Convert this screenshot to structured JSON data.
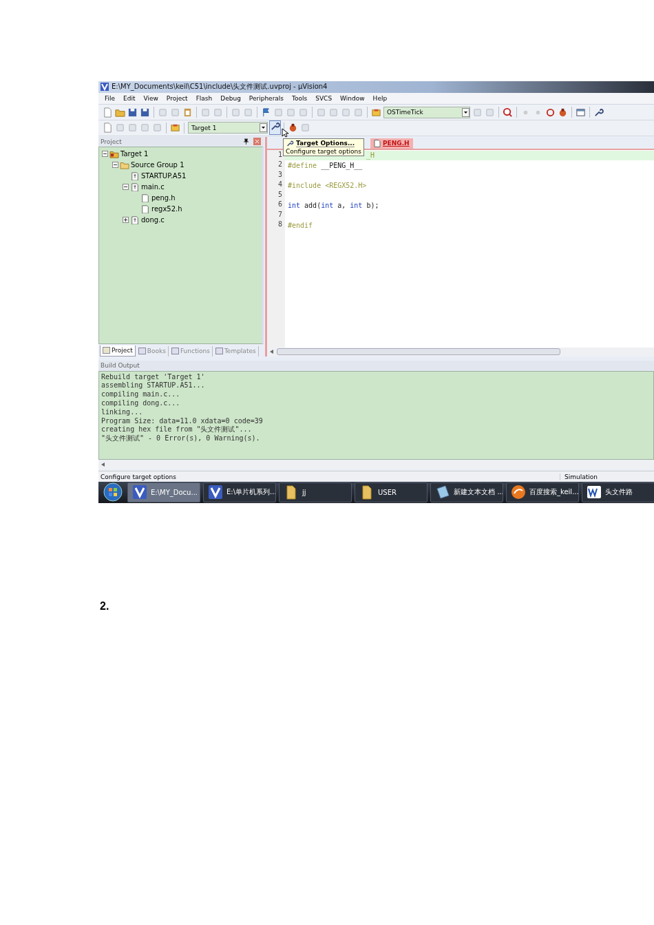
{
  "window": {
    "title": "E:\\MY_Documents\\keil\\C51\\include\\头文件测试.uvproj - µVision4"
  },
  "menu": [
    "File",
    "Edit",
    "View",
    "Project",
    "Flash",
    "Debug",
    "Peripherals",
    "Tools",
    "SVCS",
    "Window",
    "Help"
  ],
  "toolbar": {
    "function_combo": "OSTimeTick",
    "target_combo": "Target 1"
  },
  "project_panel": {
    "title": "Project",
    "tree": [
      {
        "label": "Target 1",
        "kind": "target",
        "expanded": true,
        "children": [
          {
            "label": "Source Group 1",
            "kind": "group",
            "expanded": true,
            "children": [
              {
                "label": "STARTUP.A51",
                "kind": "file"
              },
              {
                "label": "main.c",
                "kind": "file",
                "expanded": true,
                "children": [
                  {
                    "label": "peng.h",
                    "kind": "header"
                  },
                  {
                    "label": "regx52.h",
                    "kind": "header"
                  }
                ]
              },
              {
                "label": "dong.c",
                "kind": "file",
                "expanded": false
              }
            ]
          }
        ]
      }
    ],
    "tabs": [
      {
        "label": "Project",
        "selected": true
      },
      {
        "label": "Books",
        "selected": false
      },
      {
        "label": "Functions",
        "selected": false
      },
      {
        "label": "Templates",
        "selected": false
      }
    ]
  },
  "editor": {
    "tabs": [
      {
        "label": "PENG.H",
        "selected": true
      }
    ],
    "lines": [
      {
        "number": "1",
        "current": true,
        "tokens": [
          {
            "kind": "tail",
            "text": "_H"
          }
        ]
      },
      {
        "number": "2",
        "current": false,
        "tokens": [
          {
            "kind": "preproc",
            "text": "#define"
          },
          {
            "kind": "plain",
            "text": " __PENG_H__"
          }
        ]
      },
      {
        "number": "3",
        "current": false
      },
      {
        "number": "4",
        "current": false,
        "tokens": [
          {
            "kind": "preproc",
            "text": "#include <REGX52.H>"
          }
        ]
      },
      {
        "number": "5",
        "current": false
      },
      {
        "number": "6",
        "current": false,
        "tokens": [
          {
            "kind": "keyword",
            "text": "int"
          },
          {
            "kind": "plain",
            "text": " add("
          },
          {
            "kind": "keyword",
            "text": "int"
          },
          {
            "kind": "plain",
            "text": " a, "
          },
          {
            "kind": "keyword",
            "text": "int"
          },
          {
            "kind": "plain",
            "text": " b);"
          }
        ]
      },
      {
        "number": "7",
        "current": false
      },
      {
        "number": "8",
        "current": false,
        "tokens": [
          {
            "kind": "preproc",
            "text": "#endif"
          }
        ]
      }
    ]
  },
  "tooltip": {
    "title": "Target Options...",
    "description": "Configure target options"
  },
  "build_output": {
    "title": "Build Output",
    "lines": [
      "Rebuild target 'Target 1'",
      "assembling STARTUP.A51...",
      "compiling main.c...",
      "compiling dong.c...",
      "linking...",
      "Program Size: data=11.0 xdata=0 code=39",
      "creating hex file from \"头文件测试\"...",
      "\"头文件测试\" - 0 Error(s), 0 Warning(s)."
    ]
  },
  "status_bar": {
    "message": "Configure target options",
    "mode": "Simulation"
  },
  "taskbar": [
    {
      "label": "E:\\MY_Docu...",
      "kind": "app",
      "selected": true
    },
    {
      "label": "E:\\单片机系列...",
      "kind": "app",
      "selected": false
    },
    {
      "label": "jj",
      "kind": "folder",
      "selected": false
    },
    {
      "label": "USER",
      "kind": "folder",
      "selected": false
    },
    {
      "label": "新建文本文档 ...",
      "kind": "notepad",
      "selected": false
    },
    {
      "label": "百度搜索_keil...",
      "kind": "browser",
      "selected": false
    },
    {
      "label": "头文件路",
      "kind": "word",
      "selected": false
    }
  ],
  "step_label": "2."
}
